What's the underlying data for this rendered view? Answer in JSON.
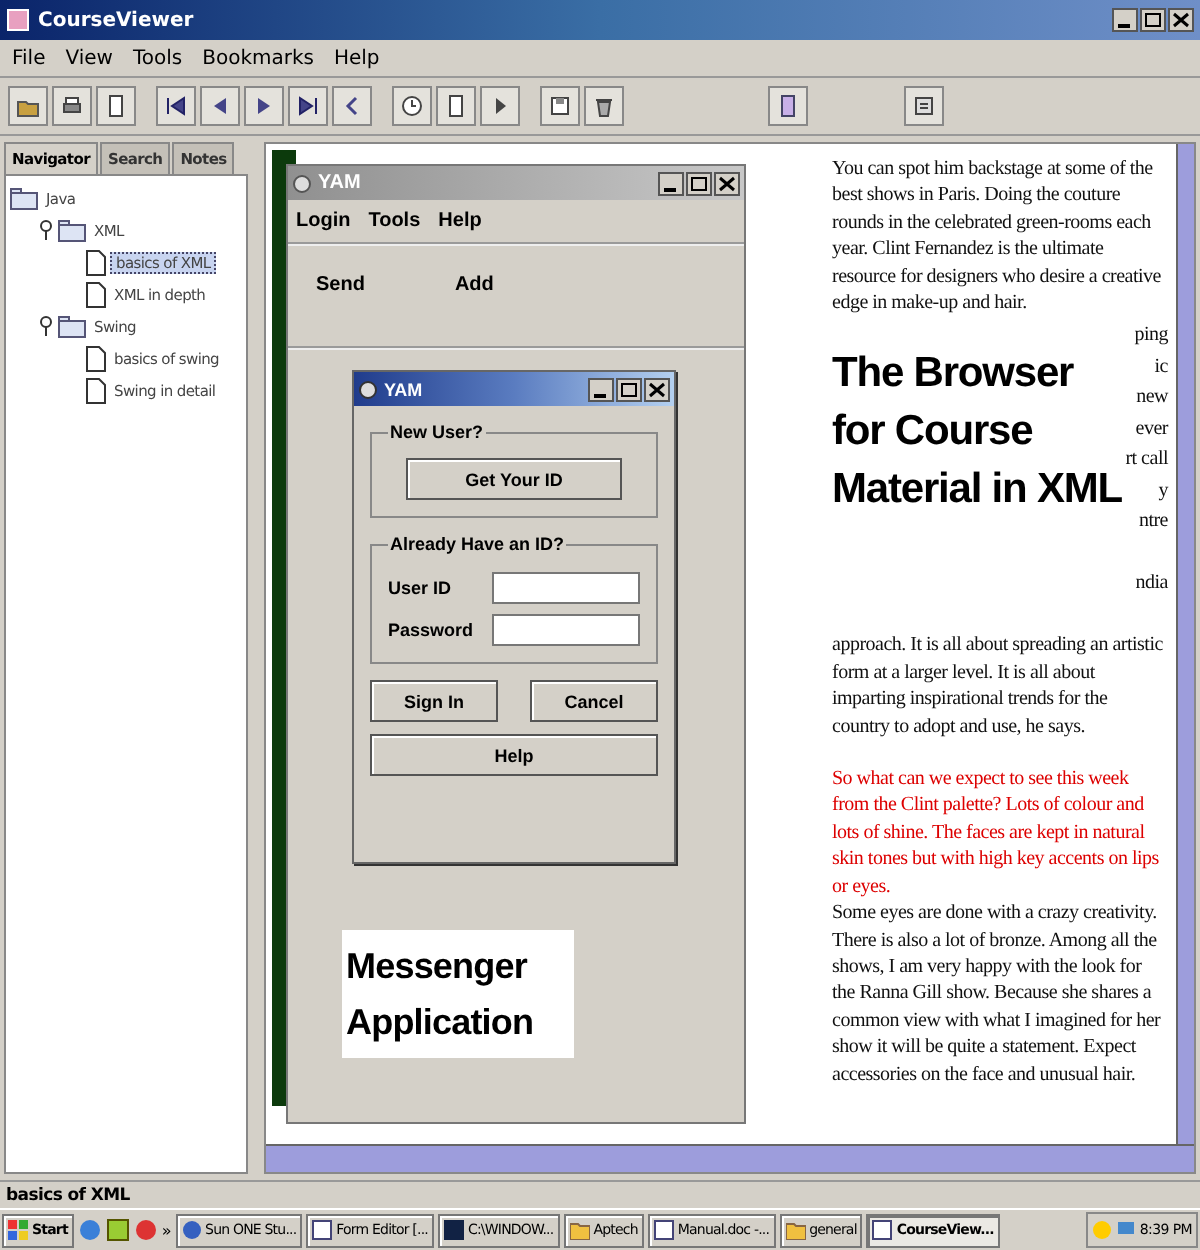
{
  "window": {
    "title": "CourseViewer"
  },
  "menu": [
    "File",
    "View",
    "Tools",
    "Bookmarks",
    "Help"
  ],
  "navigator": {
    "tabs": [
      {
        "label": "Navigator",
        "selected": true
      },
      {
        "label": "Search",
        "selected": false
      },
      {
        "label": "Notes",
        "selected": false
      }
    ],
    "tree": [
      {
        "label": "Java",
        "children": [
          {
            "label": "XML",
            "expanded": true,
            "children": [
              {
                "label": "basics of XML",
                "selected": true
              },
              {
                "label": "XML in depth",
                "selected": false
              }
            ]
          },
          {
            "label": "Swing",
            "expanded": true,
            "children": [
              {
                "label": "basics of swing",
                "selected": false
              },
              {
                "label": "Swing in detail",
                "selected": false
              }
            ]
          }
        ]
      }
    ]
  },
  "article": {
    "paragraphs": [
      {
        "kind": "normal",
        "text": "You can spot him backstage at some of the best shows in Paris. Doing the couture rounds in the celebrated green-rooms each year. Clint Fernandez is the ultimate resource for designers who desire a creative edge in make-up and hair."
      },
      {
        "kind": "covered",
        "fragments": [
          "ping",
          "ic",
          "new",
          "ever",
          "rt call",
          "y",
          "ntre",
          "ndia"
        ]
      },
      {
        "kind": "normal",
        "text": "approach. It is all about spreading an artistic form at a larger level. It is all about imparting inspirational trends for the country to adopt and use, he says."
      },
      {
        "kind": "highlight",
        "text": "So what can we expect to see this week from the Clint palette? Lots of colour and lots of shine. The faces are kept in natural skin tones but with high key accents on lips or eyes."
      },
      {
        "kind": "normal",
        "text": "Some eyes are done with a crazy creativity. There is also a lot of bronze. Among all the shows, I am very happy with the look for the Ranna Gill show. Because she shares a common view with what I imagined for her show it will be quite a statement. Expect accessories on the face and unusual hair."
      }
    ]
  },
  "captions": [
    "The Browser for Course Material in XML",
    "Messenger Application"
  ],
  "yam": {
    "title": "YAM",
    "menu": [
      "Login",
      "Tools",
      "Help"
    ],
    "toolbar": [
      "Send",
      "Add"
    ]
  },
  "yam_dialog": {
    "title": "YAM",
    "new_user": {
      "legend": "New User?",
      "button": "Get Your ID"
    },
    "login": {
      "legend": "Already Have an ID?",
      "fields": [
        {
          "label": "User ID"
        },
        {
          "label": "Password"
        }
      ]
    },
    "buttons": [
      "Sign In",
      "Cancel",
      "Help"
    ]
  },
  "status_bar": "basics of XML",
  "taskbar": {
    "start": "Start",
    "overflow": "»",
    "tasks": [
      {
        "label": "Sun ONE Stu...",
        "selected": false
      },
      {
        "label": "Form Editor [...",
        "selected": false
      },
      {
        "label": "C:\\WINDOW...",
        "selected": false
      },
      {
        "label": "Aptech",
        "selected": false
      },
      {
        "label": "Manual.doc -...",
        "selected": false
      },
      {
        "label": "general",
        "selected": false
      },
      {
        "label": "CourseView...",
        "selected": true
      }
    ],
    "clock": "8:39 PM"
  }
}
